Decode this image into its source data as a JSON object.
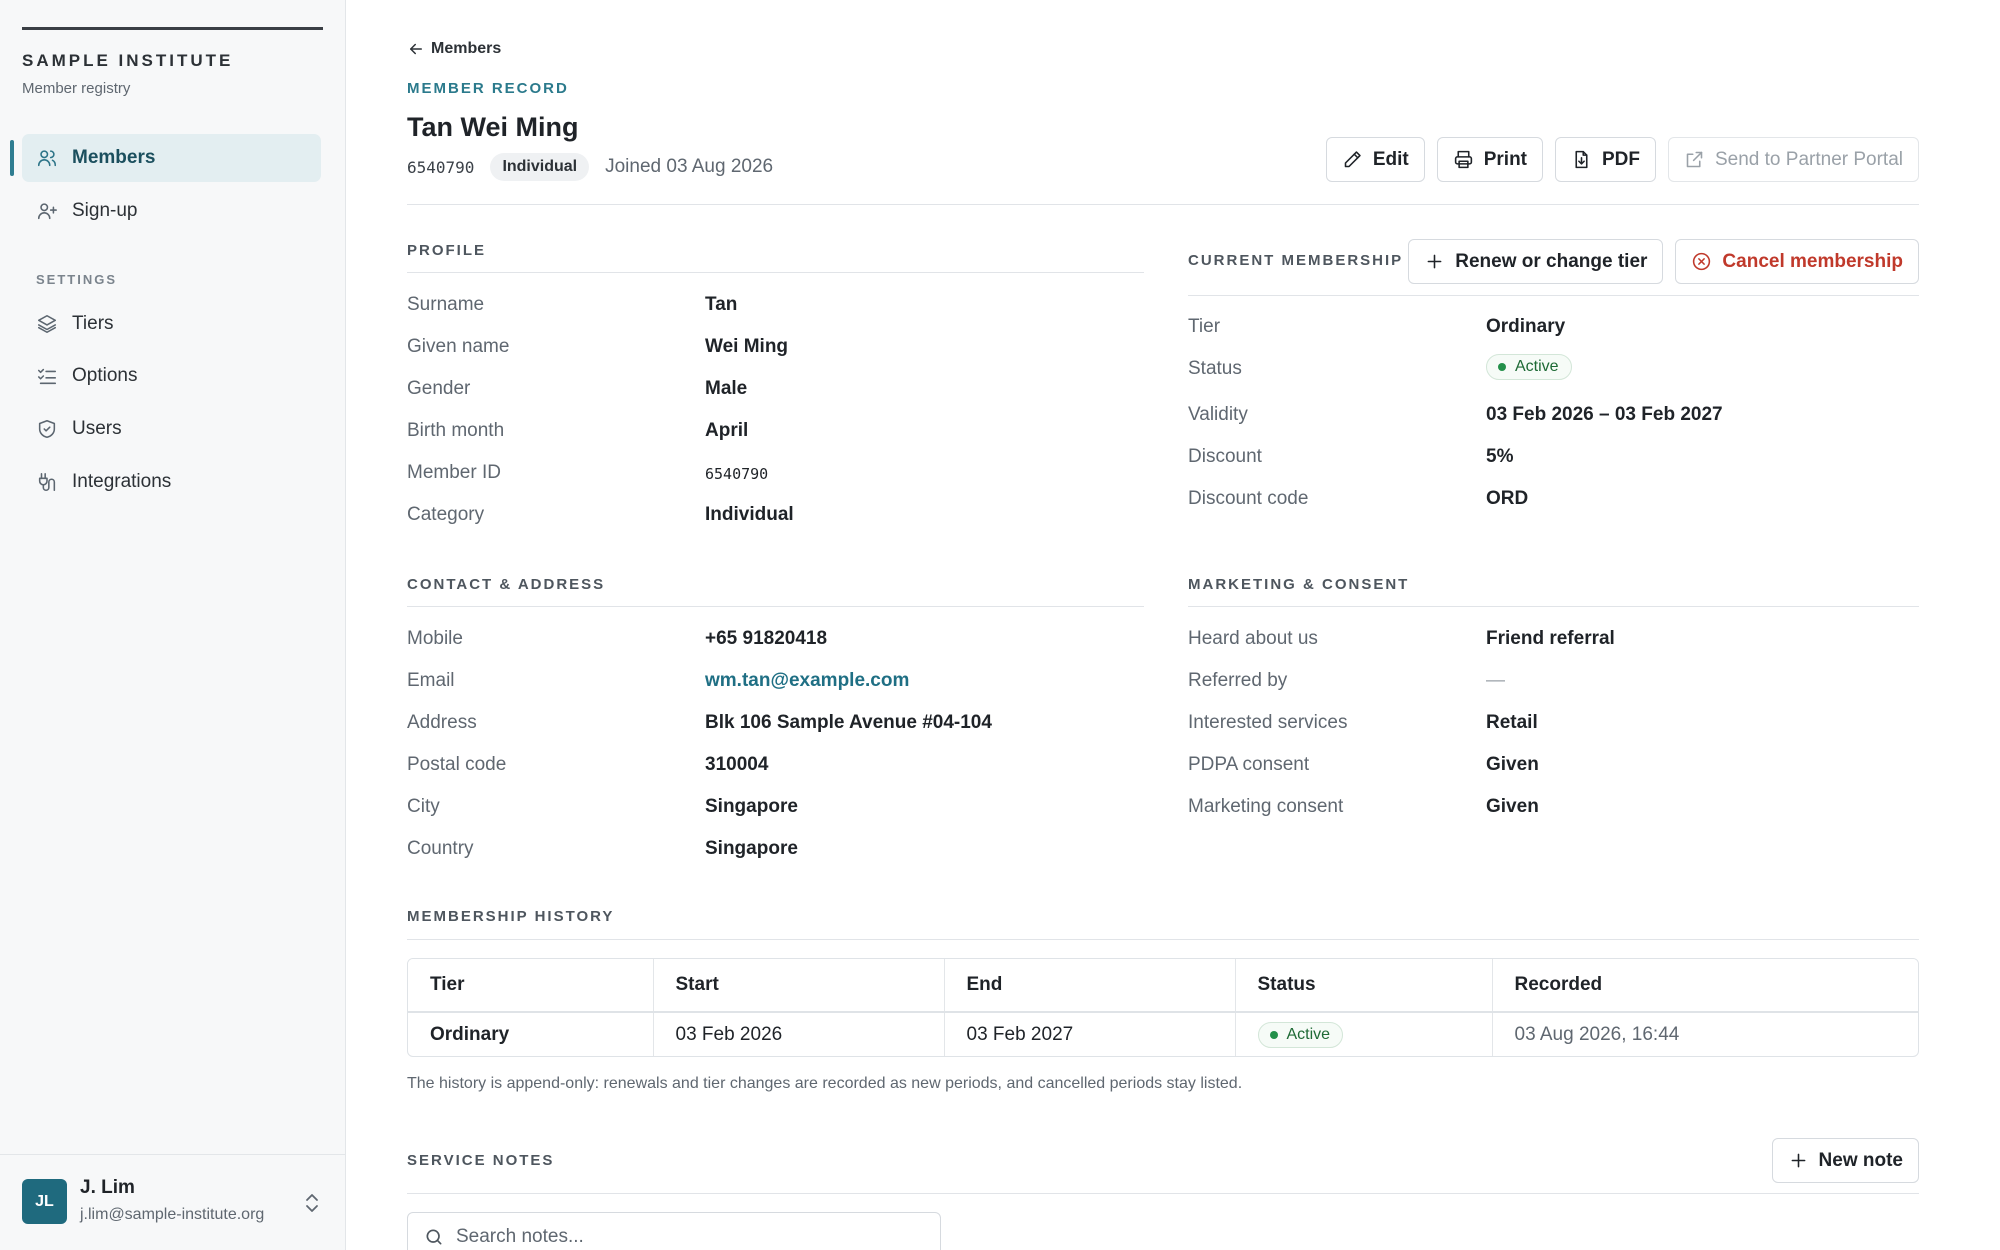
{
  "brand": {
    "name": "SAMPLE INSTITUTE",
    "subtitle": "Member registry"
  },
  "sidebar": {
    "items": [
      {
        "label": "Members",
        "icon": "users-icon",
        "active": true
      },
      {
        "label": "Sign-up",
        "icon": "user-plus-icon",
        "active": false
      }
    ],
    "settings_label": "SETTINGS",
    "settings_items": [
      {
        "label": "Tiers",
        "icon": "layers-icon"
      },
      {
        "label": "Options",
        "icon": "list-checks-icon"
      },
      {
        "label": "Users",
        "icon": "shield-icon"
      },
      {
        "label": "Integrations",
        "icon": "plug-icon"
      }
    ]
  },
  "user": {
    "initials": "JL",
    "name": "J. Lim",
    "email": "j.lim@sample-institute.org"
  },
  "header": {
    "back_label": "Members",
    "eyebrow": "MEMBER RECORD",
    "name": "Tan Wei Ming",
    "member_id": "6540790",
    "category_pill": "Individual",
    "joined": "Joined 03 Aug 2026",
    "actions": {
      "edit": "Edit",
      "print": "Print",
      "pdf": "PDF",
      "send": "Send to Partner Portal"
    }
  },
  "profile": {
    "title": "PROFILE",
    "rows": [
      {
        "label": "Surname",
        "value": "Tan"
      },
      {
        "label": "Given name",
        "value": "Wei Ming"
      },
      {
        "label": "Gender",
        "value": "Male"
      },
      {
        "label": "Birth month",
        "value": "April"
      },
      {
        "label": "Member ID",
        "value": "6540790"
      },
      {
        "label": "Category",
        "value": "Individual"
      }
    ]
  },
  "membership": {
    "title": "CURRENT MEMBERSHIP",
    "renew_label": "Renew or change tier",
    "cancel_label": "Cancel membership",
    "rows": [
      {
        "label": "Tier",
        "value": "Ordinary"
      },
      {
        "label": "Status",
        "value": "Active"
      },
      {
        "label": "Validity",
        "value": "03 Feb 2026 – 03 Feb 2027"
      },
      {
        "label": "Discount",
        "value": "5%"
      },
      {
        "label": "Discount code",
        "value": "ORD"
      }
    ]
  },
  "contact": {
    "title": "CONTACT & ADDRESS",
    "rows": [
      {
        "label": "Mobile",
        "value": "+65 91820418"
      },
      {
        "label": "Email",
        "value": "wm.tan@example.com"
      },
      {
        "label": "Address",
        "value": "Blk 106 Sample Avenue #04-104"
      },
      {
        "label": "Postal code",
        "value": "310004"
      },
      {
        "label": "City",
        "value": "Singapore"
      },
      {
        "label": "Country",
        "value": "Singapore"
      }
    ]
  },
  "marketing": {
    "title": "MARKETING & CONSENT",
    "rows": [
      {
        "label": "Heard about us",
        "value": "Friend referral"
      },
      {
        "label": "Referred by",
        "value": "—"
      },
      {
        "label": "Interested services",
        "value": "Retail"
      },
      {
        "label": "PDPA consent",
        "value": "Given"
      },
      {
        "label": "Marketing consent",
        "value": "Given"
      }
    ]
  },
  "history": {
    "title": "MEMBERSHIP HISTORY",
    "columns": [
      "Tier",
      "Start",
      "End",
      "Status",
      "Recorded"
    ],
    "rows": [
      {
        "tier": "Ordinary",
        "start": "03 Feb 2026",
        "end": "03 Feb 2027",
        "status": "Active",
        "recorded": "03 Aug 2026, 16:44"
      }
    ],
    "note": "The history is append-only: renewals and tier changes are recorded as new periods, and cancelled periods stay listed."
  },
  "notes": {
    "title": "SERVICE NOTES",
    "new_label": "New note",
    "search_placeholder": "Search notes..."
  },
  "colors": {
    "accent": "#2b7a8c",
    "active_status": "#23904a",
    "danger": "#c0392b",
    "sidebar_bg": "#f7f8f9"
  }
}
